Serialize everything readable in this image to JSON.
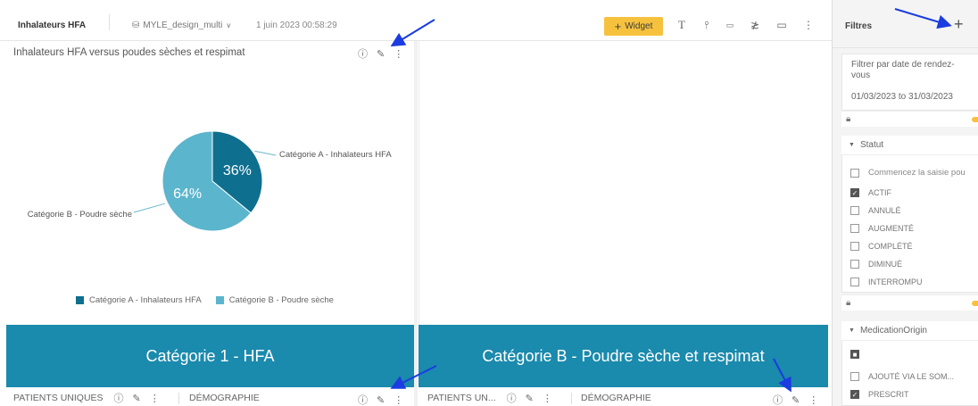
{
  "topbar": {
    "dashboard_title": "Inhalateurs HFA",
    "datasource": "MYLE_design_multi",
    "timestamp": "1 juin 2023 00:58:29",
    "widget_button": "Widget"
  },
  "widget1": {
    "title": "Inhalateurs HFA versus poudes sèches et respimat",
    "chart_data": {
      "type": "pie",
      "title": "",
      "categories": [
        "Catégorie A - Inhalateurs HFA",
        "Catégorie B - Poudre sèche"
      ],
      "values": [
        36,
        64
      ],
      "value_labels": [
        "36%",
        "64%"
      ],
      "colors": [
        "#0f6f8f",
        "#5bb5cc"
      ],
      "legend_position": "bottom"
    },
    "slice_label_a": "Catégorie A - Inhalateurs HFA",
    "slice_label_b": "Catégorie B - Poudre sèche",
    "legend_a": "Catégorie A - Inhalateurs HFA",
    "legend_b": "Catégorie B - Poudre sèche"
  },
  "banners": {
    "left": "Catégorie 1 - HFA",
    "right": "Catégorie B - Poudre sèche et respimat"
  },
  "bottom": {
    "left_a": "PATIENTS UNIQUES",
    "left_b": "DÉMOGRAPHIE",
    "right_a": "PATIENTS UN...",
    "right_b": "DÉMOGRAPHIE"
  },
  "filters": {
    "title": "Filtres",
    "date_filter_label": "Filtrer par date de rendez-vous",
    "date_range": "01/03/2023 to 31/03/2023",
    "statut_label": "Statut",
    "search_placeholder": "Commencez la saisie pou",
    "statut_options": [
      {
        "label": "ACTIF",
        "checked": true
      },
      {
        "label": "ANNULÉ",
        "checked": false
      },
      {
        "label": "AUGMENTÉ",
        "checked": false
      },
      {
        "label": "COMPLÉTÉ",
        "checked": false
      },
      {
        "label": "DIMINUÉ",
        "checked": false
      },
      {
        "label": "INTERROMPU",
        "checked": false
      }
    ],
    "medication_label": "MedicationOrigin",
    "medication_options": [
      {
        "label": "AJOUTÉ VIA LE SOM...",
        "checked": false
      },
      {
        "label": "PRESCRIT",
        "checked": true
      }
    ]
  },
  "colors": {
    "accent": "#f6c23e",
    "banner": "#1a8aad",
    "annotation": "#1a3ce0"
  }
}
